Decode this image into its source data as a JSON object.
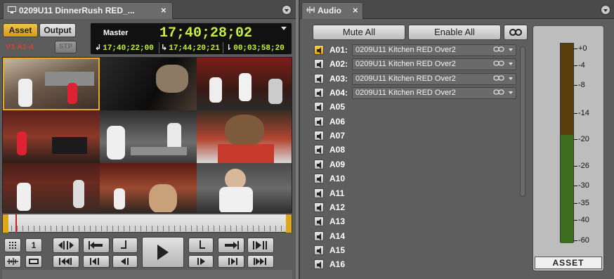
{
  "left_panel": {
    "tab_title": "0209U11 DinnerRush RED_...",
    "tab_close": "×",
    "source_buttons": {
      "asset": "Asset",
      "output": "Output"
    },
    "track_selector": "V1 A1-4",
    "stp_label": "STP",
    "monitor": {
      "label": "Master",
      "main_timecode": "17;40;28;02",
      "in_timecode": "17;40;22;00",
      "out_timecode": "17;44;20;21",
      "duration_timecode": "00;03;58;20"
    },
    "timeline_playhead_fraction": 0.02,
    "transport": {
      "one_label": "1"
    }
  },
  "right_panel": {
    "tab_title": "Audio",
    "tab_close": "×",
    "buttons": {
      "mute_all": "Mute All",
      "enable_all": "Enable All"
    },
    "tracks": [
      {
        "name": "A01:",
        "clip": "0209U11 Kitchen RED Over2",
        "active": true
      },
      {
        "name": "A02:",
        "clip": "0209U11 Kitchen RED Over2",
        "active": false
      },
      {
        "name": "A03:",
        "clip": "0209U11 Kitchen RED Over2",
        "active": false
      },
      {
        "name": "A04:",
        "clip": "0209U11 Kitchen RED Over2",
        "active": false
      },
      {
        "name": "A05",
        "clip": "",
        "active": false
      },
      {
        "name": "A06",
        "clip": "",
        "active": false
      },
      {
        "name": "A07",
        "clip": "",
        "active": false
      },
      {
        "name": "A08",
        "clip": "",
        "active": false
      },
      {
        "name": "A09",
        "clip": "",
        "active": false
      },
      {
        "name": "A10",
        "clip": "",
        "active": false
      },
      {
        "name": "A11",
        "clip": "",
        "active": false
      },
      {
        "name": "A12",
        "clip": "",
        "active": false
      },
      {
        "name": "A13",
        "clip": "",
        "active": false
      },
      {
        "name": "A14",
        "clip": "",
        "active": false
      },
      {
        "name": "A15",
        "clip": "",
        "active": false
      },
      {
        "name": "A16",
        "clip": "",
        "active": false
      }
    ],
    "meter": {
      "scale": [
        "+0",
        "-4",
        "-8",
        "-14",
        "-20",
        "-26",
        "-30",
        "-35",
        "-40",
        "-60"
      ],
      "label": "ASSET"
    }
  },
  "colors": {
    "accent_yellow": "#e9a820",
    "timecode_green": "#c8ef3a",
    "meter_green": "#3c7a22",
    "meter_amber": "#7a5a10"
  }
}
